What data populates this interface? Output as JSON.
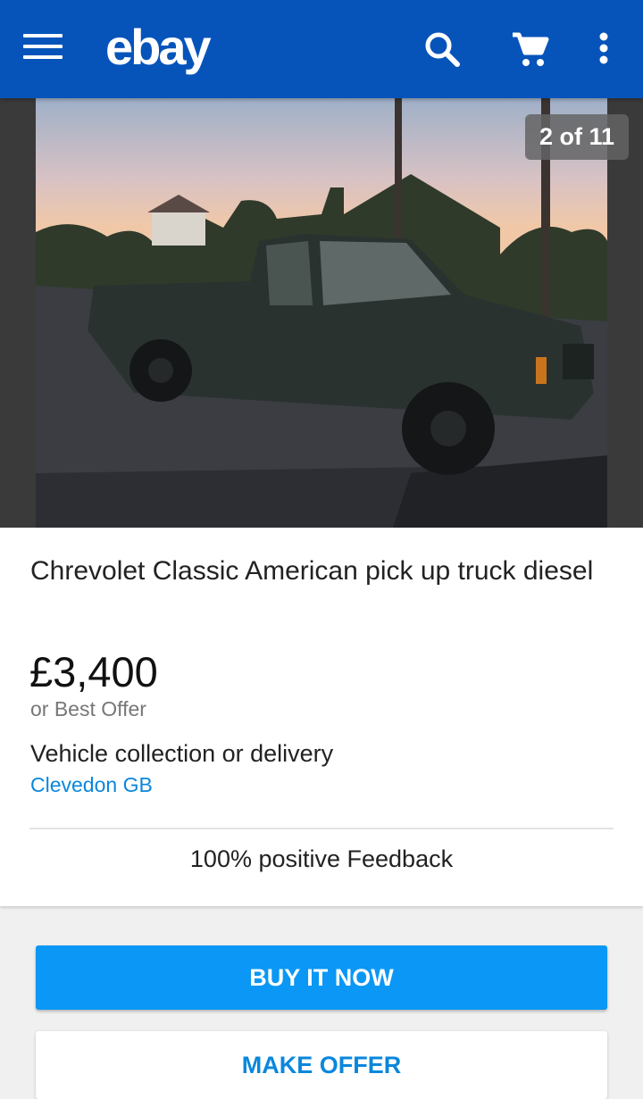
{
  "header": {
    "logo_text": "ebay",
    "menu_icon": "hamburger-menu-icon",
    "search_icon": "search-icon",
    "cart_icon": "cart-icon",
    "more_icon": "more-vertical-icon",
    "background_color": "#0654ba"
  },
  "gallery": {
    "counter": "2 of 11"
  },
  "listing": {
    "title": "Chrevolet Classic American pick up truck diesel",
    "price": "£3,400",
    "offer_text": "or Best Offer",
    "delivery": "Vehicle collection or delivery",
    "location": "Clevedon GB",
    "feedback": "100% positive Feedback"
  },
  "actions": {
    "buy_now_label": "BUY IT NOW",
    "make_offer_label": "MAKE OFFER",
    "buy_now_color": "#0a97f5",
    "link_color": "#0b87dc"
  }
}
